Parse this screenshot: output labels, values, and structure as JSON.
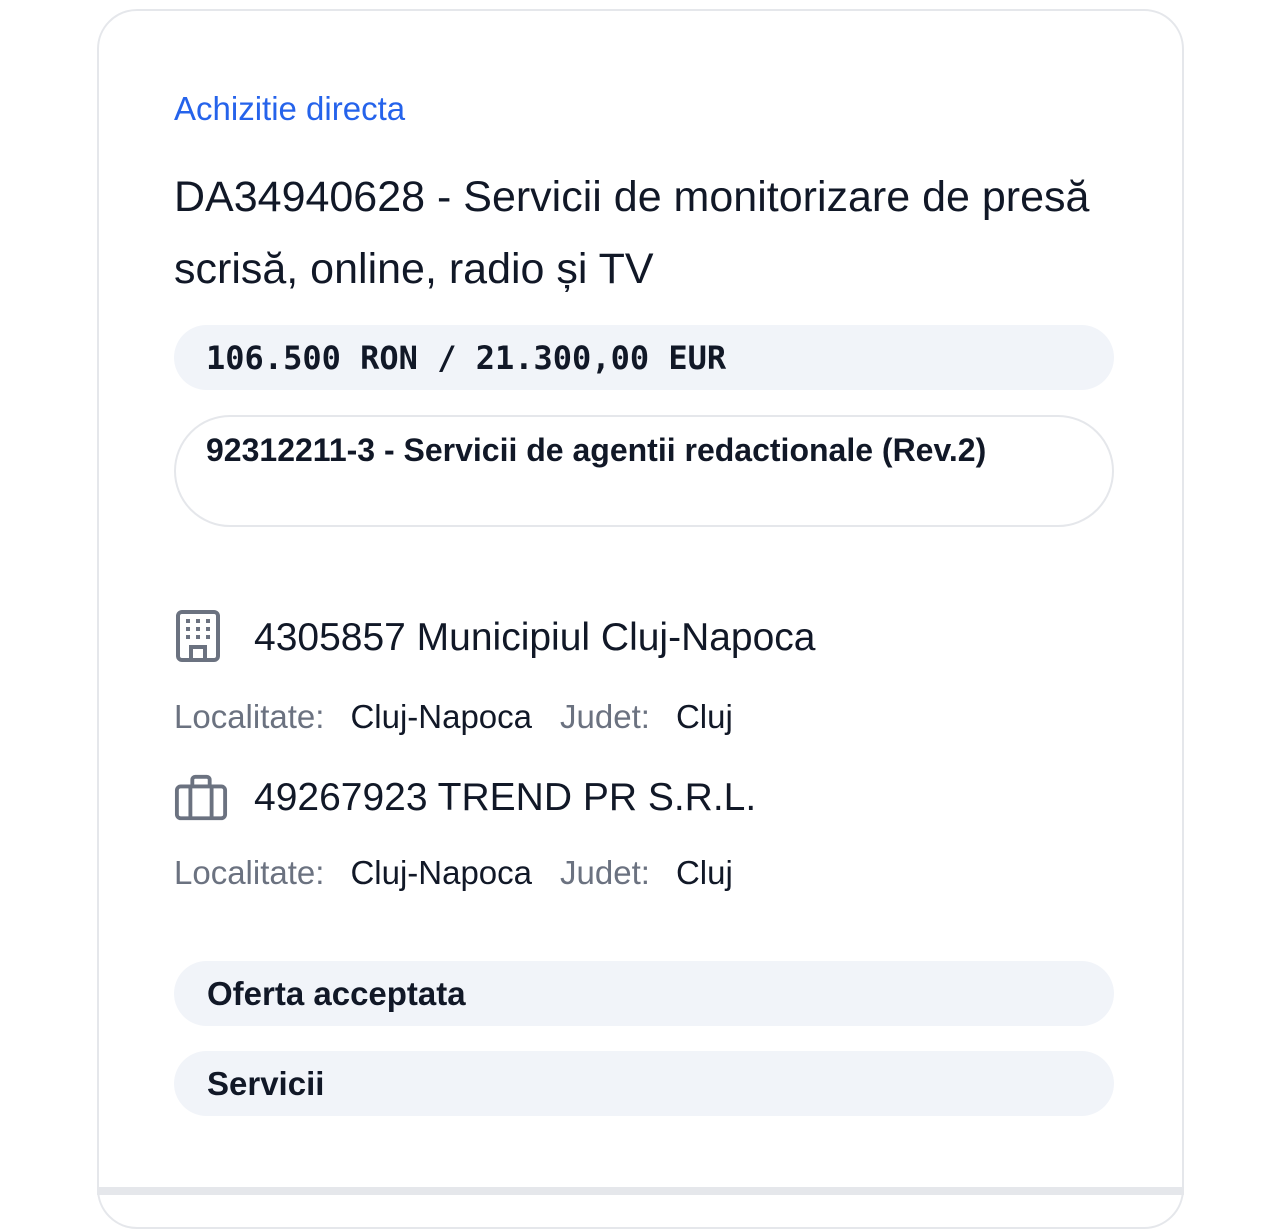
{
  "procurement": {
    "type_label": "Achizitie directa",
    "title": "DA34940628 - Servicii de monitorizare de presă scrisă, online, radio și TV",
    "value": "106.500 RON / 21.300,00 EUR",
    "cpv": "92312211-3 - Servicii de agentii redactionale (Rev.2)"
  },
  "authority": {
    "icon": "building-icon",
    "name": "4305857 Municipiul Cluj-Napoca",
    "locality_label": "Localitate:",
    "locality": "Cluj-Napoca",
    "county_label": "Judet:",
    "county": "Cluj"
  },
  "supplier": {
    "icon": "briefcase-icon",
    "name": "49267923 TREND PR S.R.L.",
    "locality_label": "Localitate:",
    "locality": "Cluj-Napoca",
    "county_label": "Judet:",
    "county": "Cluj"
  },
  "status": "Oferta acceptata",
  "category": "Servicii",
  "colors": {
    "accent": "#2563eb",
    "pill_bg": "#f1f4f9",
    "border": "#e5e7eb",
    "muted_text": "#6b7280",
    "icon_gray": "#6b7280"
  }
}
